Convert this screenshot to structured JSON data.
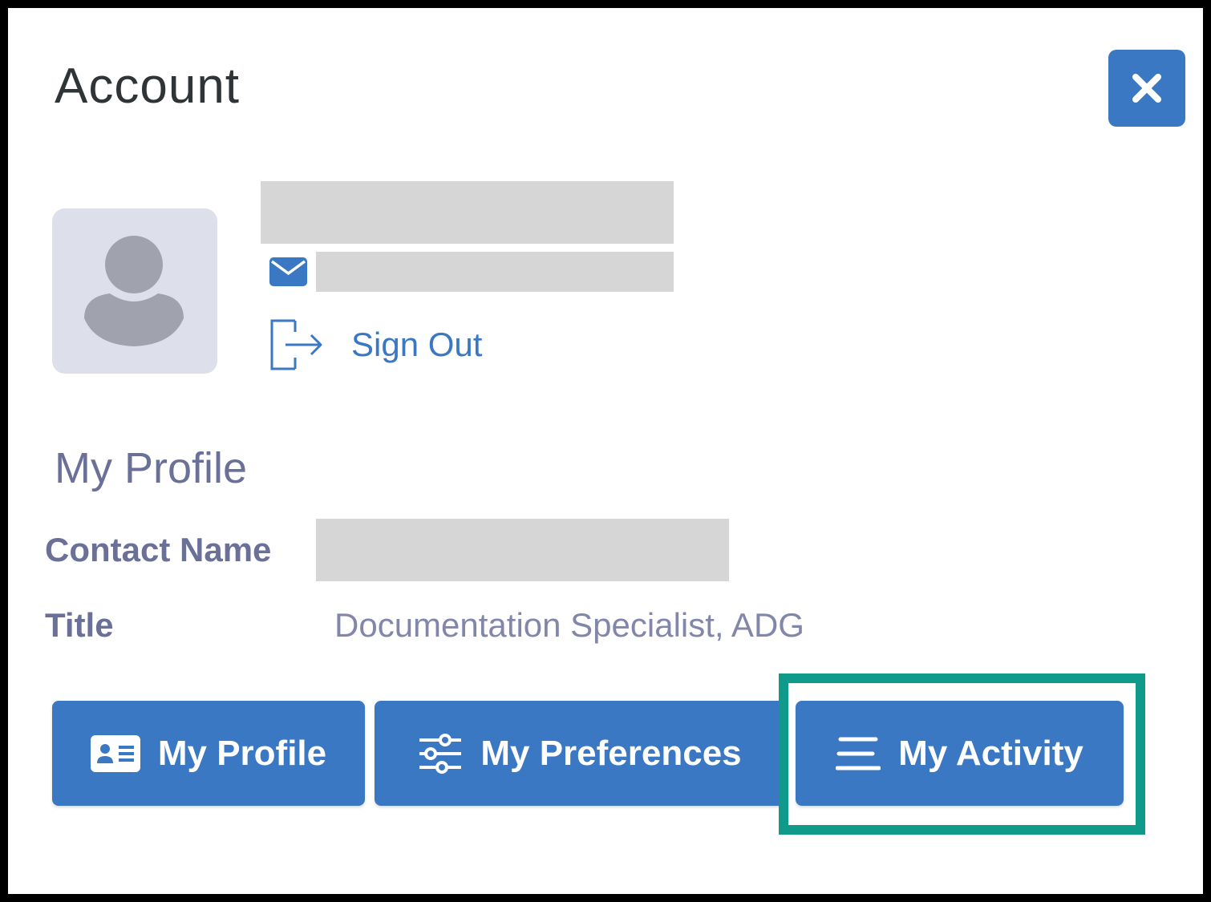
{
  "dialog": {
    "title": "Account",
    "close_icon": "close-icon"
  },
  "user": {
    "avatar_icon": "user-silhouette-icon",
    "email_icon": "envelope-icon",
    "sign_out_label": "Sign Out",
    "sign_out_icon": "sign-out-icon"
  },
  "profile": {
    "section_title": "My Profile",
    "fields": [
      {
        "label": "Contact Name",
        "value": ""
      },
      {
        "label": "Title",
        "value": "Documentation Specialist, ADG"
      }
    ]
  },
  "actions": [
    {
      "label": "My Profile",
      "icon": "id-card-icon"
    },
    {
      "label": "My Preferences",
      "icon": "sliders-icon"
    },
    {
      "label": "My Activity",
      "icon": "list-lines-icon"
    }
  ],
  "colors": {
    "accent": "#3b78c3",
    "highlight": "#0f9a8a",
    "label_text": "#6b7099"
  }
}
